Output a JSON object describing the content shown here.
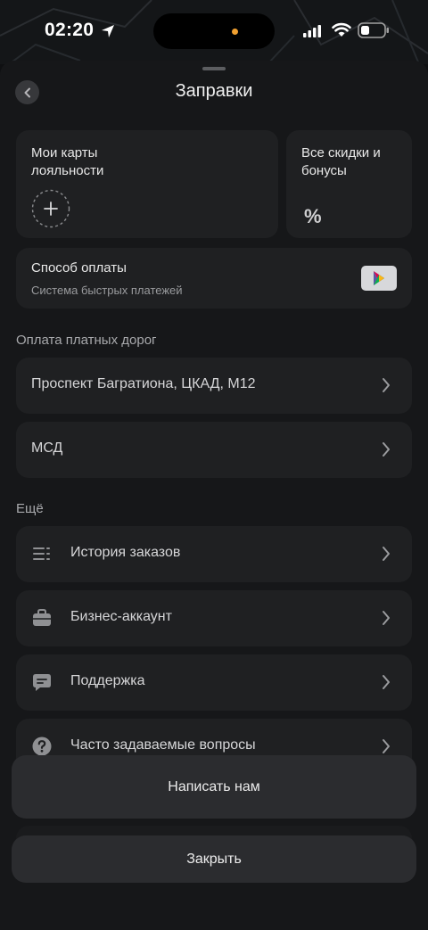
{
  "status": {
    "time": "02:20"
  },
  "header": {
    "title": "Заправки"
  },
  "loyalty": {
    "title": "Мои карты лояльности"
  },
  "discounts": {
    "title": "Все скидки и бонусы",
    "icon": "%"
  },
  "payment": {
    "title": "Способ оплаты",
    "subtitle": "Система быстрых платежей"
  },
  "roads": {
    "section": "Оплата платных дорог",
    "items": [
      {
        "label": "Проспект Багратиона, ЦКАД, М12"
      },
      {
        "label": "МСД"
      }
    ]
  },
  "more": {
    "section": "Ещё",
    "items": [
      {
        "label": "История заказов",
        "icon": "list-icon"
      },
      {
        "label": "Бизнес-аккаунт",
        "icon": "briefcase-icon"
      },
      {
        "label": "Поддержка",
        "icon": "chat-icon"
      },
      {
        "label": "Часто задаваемые вопросы",
        "icon": "question-icon"
      }
    ]
  },
  "actions": {
    "write": "Написать нам",
    "close": "Закрыть"
  },
  "colors": {
    "sheet": "#161719",
    "card": "#1f2022",
    "accent_dot": "#f0a030"
  }
}
